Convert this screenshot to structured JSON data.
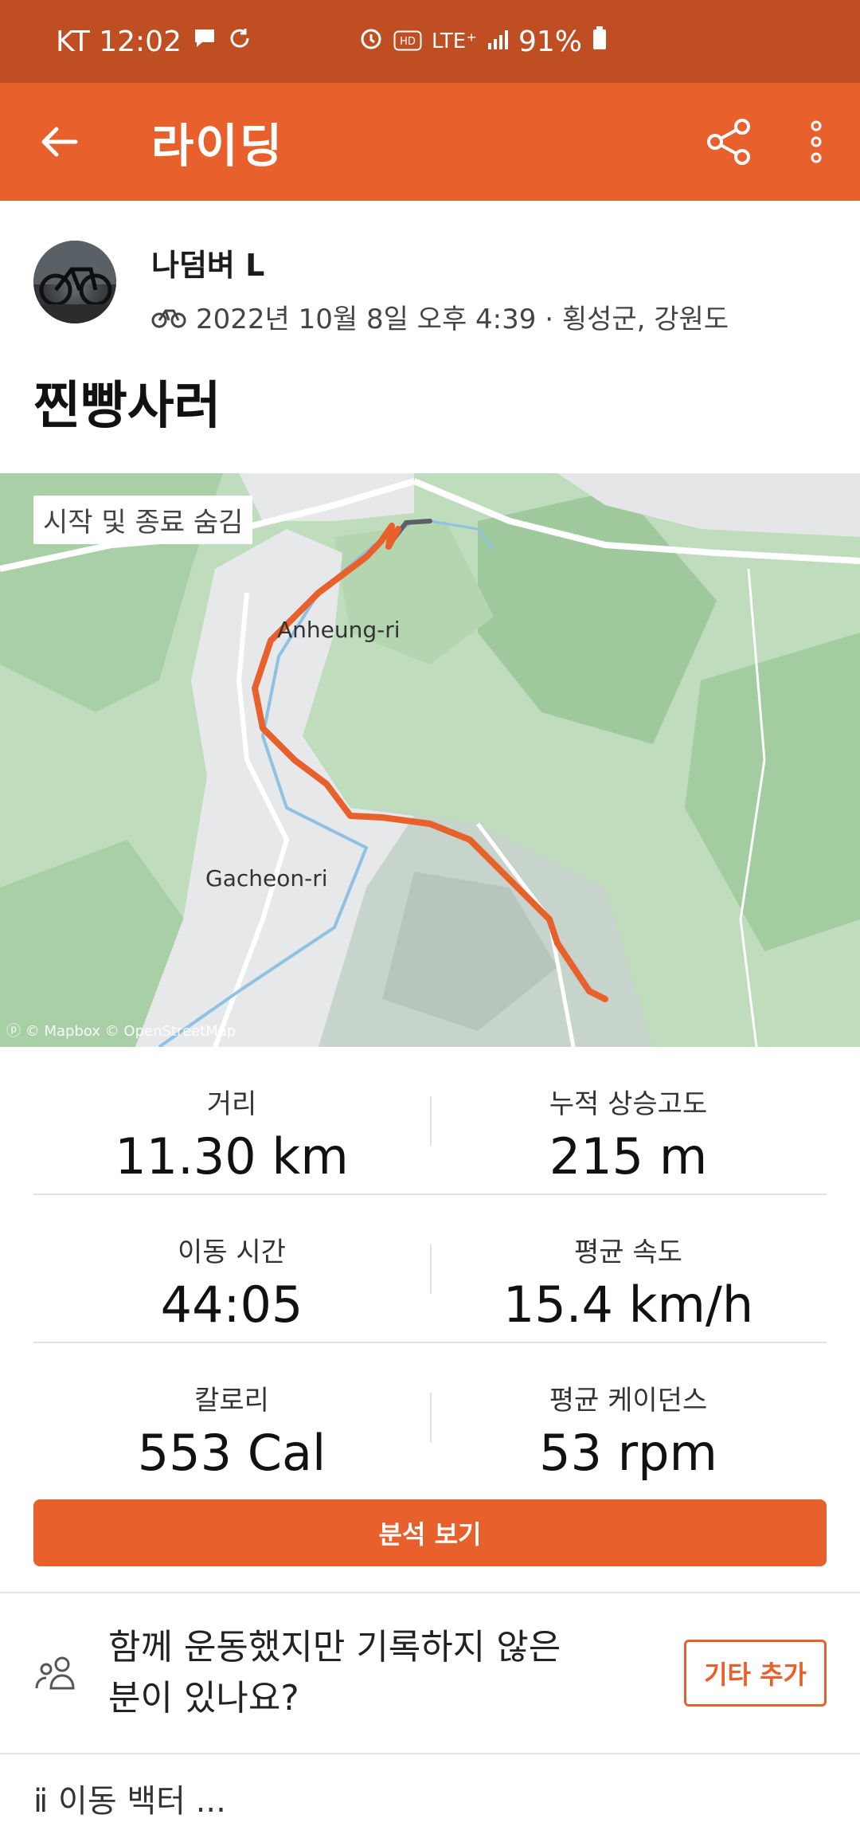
{
  "status_bar": {
    "carrier_time": "KT 12:02",
    "network": "LTE⁺",
    "battery": "91%"
  },
  "app_bar": {
    "title": "라이딩"
  },
  "athlete": {
    "name": "나덤벼 L",
    "meta": "2022년 10월 8일 오후 4:39 · 횡성군, 강원도"
  },
  "activity": {
    "title": "찐빵사러"
  },
  "map": {
    "toggle_label": "시작 및 종료 숨김",
    "label_1": "Anheung-ri",
    "label_2": "Gacheon-ri",
    "attribution": "© Mapbox © OpenStreetMap",
    "route_color": "#e8612c"
  },
  "stats": [
    {
      "label": "거리",
      "value": "11.30 km"
    },
    {
      "label": "누적 상승고도",
      "value": "215 m"
    },
    {
      "label": "이동 시간",
      "value": "44:05"
    },
    {
      "label": "평균 속도",
      "value": "15.4 km/h"
    },
    {
      "label": "칼로리",
      "value": "553 Cal"
    },
    {
      "label": "평균 케이던스",
      "value": "53 rpm"
    }
  ],
  "analysis_button": "분석 보기",
  "together": {
    "line1": "함께 운동했지만 기록하지 않은",
    "line2": "분이 있나요?",
    "add_button": "기타 추가"
  },
  "bottom_partial": "ⅱ 이동 백터 ..."
}
